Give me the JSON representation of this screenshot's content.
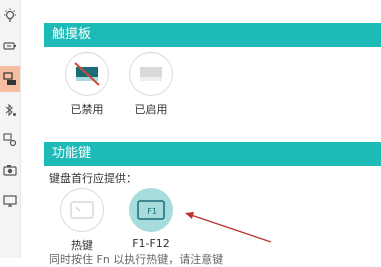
{
  "sidebar": {
    "items": [
      {
        "icon": "lightbulb-icon"
      },
      {
        "icon": "battery-icon"
      },
      {
        "icon": "keyboard-touchpad-icon",
        "active": true
      },
      {
        "icon": "bluetooth-settings-icon"
      },
      {
        "icon": "network-settings-icon"
      },
      {
        "icon": "camera-icon"
      },
      {
        "icon": "monitor-icon"
      }
    ]
  },
  "touchpad": {
    "title": "触摸板",
    "options": [
      {
        "label": "已禁用",
        "selected": true
      },
      {
        "label": "已启用",
        "selected": false
      }
    ]
  },
  "function_keys": {
    "title": "功能键",
    "description": "键盘首行应提供：",
    "options": [
      {
        "label": "热键",
        "selected": false
      },
      {
        "label": "F1-F12",
        "icon_text": "F1",
        "selected": true
      }
    ],
    "bottom_text": "同时按住 Fn 以执行热键，请注意键"
  },
  "colors": {
    "accent": "#1dbab8",
    "selected_circle": "#a6dcdc",
    "sidebar_active": "#f6bda1",
    "arrow": "#b8322e"
  }
}
